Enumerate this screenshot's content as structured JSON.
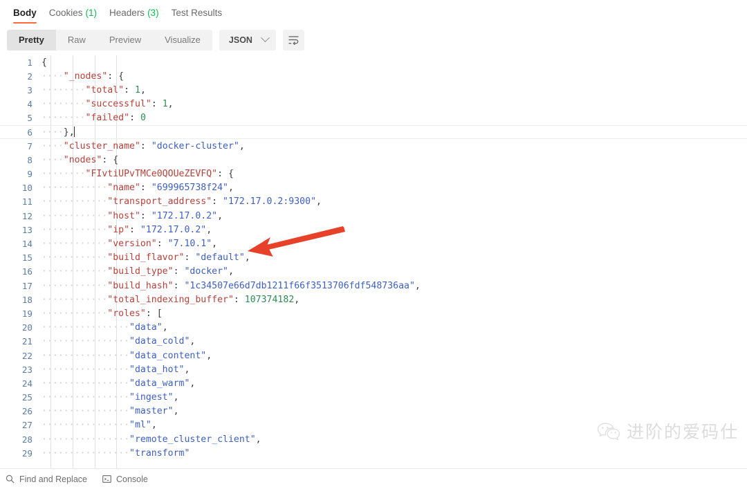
{
  "tabs": [
    {
      "label": "Body",
      "count": "",
      "active": true
    },
    {
      "label": "Cookies",
      "count": "(1)",
      "active": false
    },
    {
      "label": "Headers",
      "count": "(3)",
      "active": false
    },
    {
      "label": "Test Results",
      "count": "",
      "active": false
    }
  ],
  "toolbar": {
    "views": [
      "Pretty",
      "Raw",
      "Preview",
      "Visualize"
    ],
    "active_view": "Pretty",
    "format_selected": "JSON",
    "format_dropdown_icon": "chevron-down-icon",
    "wrap_button_icon": "wrap-text-icon"
  },
  "editor": {
    "language": "json",
    "cursor_line": 6,
    "first_line": 1,
    "last_line": 29,
    "lines": [
      {
        "n": 1,
        "indent": 0,
        "tokens": [
          {
            "t": "p",
            "v": "{"
          }
        ]
      },
      {
        "n": 2,
        "indent": 1,
        "tokens": [
          {
            "t": "k",
            "v": "\"_nodes\""
          },
          {
            "t": "p",
            "v": ": {"
          }
        ]
      },
      {
        "n": 3,
        "indent": 2,
        "tokens": [
          {
            "t": "k",
            "v": "\"total\""
          },
          {
            "t": "p",
            "v": ": "
          },
          {
            "t": "n",
            "v": "1"
          },
          {
            "t": "p",
            "v": ","
          }
        ]
      },
      {
        "n": 4,
        "indent": 2,
        "tokens": [
          {
            "t": "k",
            "v": "\"successful\""
          },
          {
            "t": "p",
            "v": ": "
          },
          {
            "t": "n",
            "v": "1"
          },
          {
            "t": "p",
            "v": ","
          }
        ]
      },
      {
        "n": 5,
        "indent": 2,
        "tokens": [
          {
            "t": "k",
            "v": "\"failed\""
          },
          {
            "t": "p",
            "v": ": "
          },
          {
            "t": "n",
            "v": "0"
          }
        ]
      },
      {
        "n": 6,
        "indent": 1,
        "tokens": [
          {
            "t": "p",
            "v": "},"
          }
        ],
        "caret": true
      },
      {
        "n": 7,
        "indent": 1,
        "tokens": [
          {
            "t": "k",
            "v": "\"cluster_name\""
          },
          {
            "t": "p",
            "v": ": "
          },
          {
            "t": "s",
            "v": "\"docker-cluster\""
          },
          {
            "t": "p",
            "v": ","
          }
        ]
      },
      {
        "n": 8,
        "indent": 1,
        "tokens": [
          {
            "t": "k",
            "v": "\"nodes\""
          },
          {
            "t": "p",
            "v": ": {"
          }
        ]
      },
      {
        "n": 9,
        "indent": 2,
        "tokens": [
          {
            "t": "k",
            "v": "\"FIvtiUPvTMCe0QOUeZEVFQ\""
          },
          {
            "t": "p",
            "v": ": {"
          }
        ]
      },
      {
        "n": 10,
        "indent": 3,
        "tokens": [
          {
            "t": "k",
            "v": "\"name\""
          },
          {
            "t": "p",
            "v": ": "
          },
          {
            "t": "s",
            "v": "\"699965738f24\""
          },
          {
            "t": "p",
            "v": ","
          }
        ]
      },
      {
        "n": 11,
        "indent": 3,
        "tokens": [
          {
            "t": "k",
            "v": "\"transport_address\""
          },
          {
            "t": "p",
            "v": ": "
          },
          {
            "t": "s",
            "v": "\"172.17.0.2:9300\""
          },
          {
            "t": "p",
            "v": ","
          }
        ]
      },
      {
        "n": 12,
        "indent": 3,
        "tokens": [
          {
            "t": "k",
            "v": "\"host\""
          },
          {
            "t": "p",
            "v": ": "
          },
          {
            "t": "s",
            "v": "\"172.17.0.2\""
          },
          {
            "t": "p",
            "v": ","
          }
        ]
      },
      {
        "n": 13,
        "indent": 3,
        "tokens": [
          {
            "t": "k",
            "v": "\"ip\""
          },
          {
            "t": "p",
            "v": ": "
          },
          {
            "t": "s",
            "v": "\"172.17.0.2\""
          },
          {
            "t": "p",
            "v": ","
          }
        ]
      },
      {
        "n": 14,
        "indent": 3,
        "tokens": [
          {
            "t": "k",
            "v": "\"version\""
          },
          {
            "t": "p",
            "v": ": "
          },
          {
            "t": "s",
            "v": "\"7.10.1\""
          },
          {
            "t": "p",
            "v": ","
          }
        ]
      },
      {
        "n": 15,
        "indent": 3,
        "tokens": [
          {
            "t": "k",
            "v": "\"build_flavor\""
          },
          {
            "t": "p",
            "v": ": "
          },
          {
            "t": "s",
            "v": "\"default\""
          },
          {
            "t": "p",
            "v": ","
          }
        ]
      },
      {
        "n": 16,
        "indent": 3,
        "tokens": [
          {
            "t": "k",
            "v": "\"build_type\""
          },
          {
            "t": "p",
            "v": ": "
          },
          {
            "t": "s",
            "v": "\"docker\""
          },
          {
            "t": "p",
            "v": ","
          }
        ]
      },
      {
        "n": 17,
        "indent": 3,
        "tokens": [
          {
            "t": "k",
            "v": "\"build_hash\""
          },
          {
            "t": "p",
            "v": ": "
          },
          {
            "t": "s",
            "v": "\"1c34507e66d7db1211f66f3513706fdf548736aa\""
          },
          {
            "t": "p",
            "v": ","
          }
        ]
      },
      {
        "n": 18,
        "indent": 3,
        "tokens": [
          {
            "t": "k",
            "v": "\"total_indexing_buffer\""
          },
          {
            "t": "p",
            "v": ": "
          },
          {
            "t": "n",
            "v": "107374182"
          },
          {
            "t": "p",
            "v": ","
          }
        ]
      },
      {
        "n": 19,
        "indent": 3,
        "tokens": [
          {
            "t": "k",
            "v": "\"roles\""
          },
          {
            "t": "p",
            "v": ": ["
          }
        ]
      },
      {
        "n": 20,
        "indent": 4,
        "tokens": [
          {
            "t": "s",
            "v": "\"data\""
          },
          {
            "t": "p",
            "v": ","
          }
        ]
      },
      {
        "n": 21,
        "indent": 4,
        "tokens": [
          {
            "t": "s",
            "v": "\"data_cold\""
          },
          {
            "t": "p",
            "v": ","
          }
        ]
      },
      {
        "n": 22,
        "indent": 4,
        "tokens": [
          {
            "t": "s",
            "v": "\"data_content\""
          },
          {
            "t": "p",
            "v": ","
          }
        ]
      },
      {
        "n": 23,
        "indent": 4,
        "tokens": [
          {
            "t": "s",
            "v": "\"data_hot\""
          },
          {
            "t": "p",
            "v": ","
          }
        ]
      },
      {
        "n": 24,
        "indent": 4,
        "tokens": [
          {
            "t": "s",
            "v": "\"data_warm\""
          },
          {
            "t": "p",
            "v": ","
          }
        ]
      },
      {
        "n": 25,
        "indent": 4,
        "tokens": [
          {
            "t": "s",
            "v": "\"ingest\""
          },
          {
            "t": "p",
            "v": ","
          }
        ]
      },
      {
        "n": 26,
        "indent": 4,
        "tokens": [
          {
            "t": "s",
            "v": "\"master\""
          },
          {
            "t": "p",
            "v": ","
          }
        ]
      },
      {
        "n": 27,
        "indent": 4,
        "tokens": [
          {
            "t": "s",
            "v": "\"ml\""
          },
          {
            "t": "p",
            "v": ","
          }
        ]
      },
      {
        "n": 28,
        "indent": 4,
        "tokens": [
          {
            "t": "s",
            "v": "\"remote_cluster_client\""
          },
          {
            "t": "p",
            "v": ","
          }
        ]
      },
      {
        "n": 29,
        "indent": 4,
        "tokens": [
          {
            "t": "s",
            "v": "\"transform\""
          }
        ]
      }
    ]
  },
  "annotation": {
    "type": "arrow",
    "color": "#e8412a",
    "points_to_line": 10,
    "direction": "left"
  },
  "watermark": {
    "icon": "wechat-icon",
    "text": "进阶的爱码仕"
  },
  "footer": {
    "items": [
      {
        "label": "Find and Replace",
        "icon": "search-icon"
      },
      {
        "label": "Console",
        "icon": "console-icon"
      }
    ]
  },
  "colors": {
    "accent": "#ff6c37",
    "count_green": "#0cbb52",
    "json_key": "#b5423a",
    "json_string": "#3d5fc4",
    "json_number": "#2f8a55",
    "gutter_number": "#5c7ca8",
    "annotation_red": "#e8412a"
  }
}
